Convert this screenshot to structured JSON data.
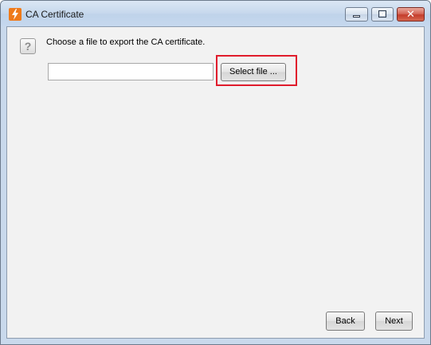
{
  "window": {
    "title": "CA Certificate",
    "icon": "app-logo-icon",
    "controls": {
      "minimize": "minimize-icon",
      "maximize": "maximize-icon",
      "close_glyph": "✕"
    }
  },
  "content": {
    "help_glyph": "?",
    "prompt": "Choose a file to export the CA certificate.",
    "file_path": {
      "value": "",
      "placeholder": ""
    },
    "select_file_label": "Select file ..."
  },
  "footer": {
    "back_label": "Back",
    "next_label": "Next"
  },
  "colors": {
    "highlight_border": "#e01c2c",
    "app_icon": "#ef7a1a",
    "titlebar": "#c8d9ed",
    "client_bg": "#f2f2f2"
  }
}
